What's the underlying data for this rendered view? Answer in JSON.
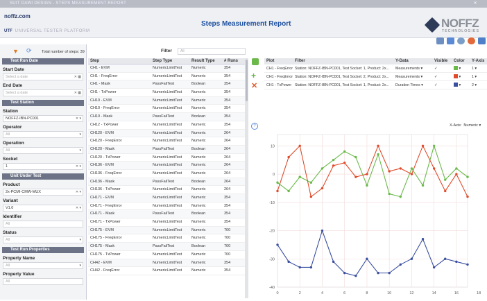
{
  "window": {
    "title": "SUIT DAWI DESIGN - STEPS MEASUREMENT REPORT"
  },
  "header": {
    "logo_text": "noffz.com",
    "app_abbrev": "UTF",
    "app_name": "UNIVERSAL TESTER PLATFORM",
    "report_title": "Steps Measurement Report",
    "brand": "NOFFZ",
    "brand_sub": "TECHNOLOGIES"
  },
  "left_panel": {
    "total_label": "Total number of steps: 39",
    "sections": {
      "test_run_date": "Test Run Date",
      "test_station": "Test Station",
      "unit_under_test": "Unit Under Test",
      "test_run_properties": "Test Run Properties"
    },
    "fields": {
      "start_date": {
        "label": "Start Date",
        "placeholder": "Select a date"
      },
      "end_date": {
        "label": "End Date",
        "placeholder": "Select a date"
      },
      "station": {
        "label": "Station",
        "value": "NOFFZ-IBN-PC001"
      },
      "operator": {
        "label": "Operator",
        "value": "All"
      },
      "operation": {
        "label": "Operation",
        "value": "All"
      },
      "socket": {
        "label": "Socket",
        "value": "1"
      },
      "product": {
        "label": "Product",
        "value": "2x-PCMI-CMW-MUX"
      },
      "variant": {
        "label": "Variant",
        "value": "V1.0"
      },
      "identifier": {
        "label": "Identifier",
        "value": "All"
      },
      "status": {
        "label": "Status",
        "value": "All"
      },
      "property_name": {
        "label": "Property Name",
        "value": "All"
      },
      "property_value": {
        "label": "Property Value",
        "value": "All"
      }
    }
  },
  "filter": {
    "label": "Filter",
    "placeholder": "All"
  },
  "steps_table": {
    "headers": [
      "Step",
      "Step Type",
      "Result Type",
      "# Runs"
    ],
    "rows": [
      [
        "CH1 - EVM",
        "NumericLimitTest",
        "Numeric",
        "354"
      ],
      [
        "CH1 - FreqError",
        "NumericLimitTest",
        "Numeric",
        "354"
      ],
      [
        "CH1 - Mask",
        "PassFailTest",
        "Boolean",
        "354"
      ],
      [
        "CH1 - TxPower",
        "NumericLimitTest",
        "Numeric",
        "354"
      ],
      [
        "CH10 - EVM",
        "NumericLimitTest",
        "Numeric",
        "354"
      ],
      [
        "CH10 - FreqError",
        "NumericLimitTest",
        "Numeric",
        "354"
      ],
      [
        "CH10 - Mask",
        "PassFailTest",
        "Boolean",
        "354"
      ],
      [
        "CH12 - TxPower",
        "NumericLimitTest",
        "Numeric",
        "354"
      ],
      [
        "CH120 - EVM",
        "NumericLimitTest",
        "Numeric",
        "264"
      ],
      [
        "CH120 - FreqError",
        "NumericLimitTest",
        "Numeric",
        "264"
      ],
      [
        "CH120 - Mask",
        "PassFailTest",
        "Boolean",
        "264"
      ],
      [
        "CH120 - TxPower",
        "NumericLimitTest",
        "Numeric",
        "264"
      ],
      [
        "CH136 - EVM",
        "NumericLimitTest",
        "Numeric",
        "264"
      ],
      [
        "CH136 - FreqError",
        "NumericLimitTest",
        "Numeric",
        "264"
      ],
      [
        "CH136 - Mask",
        "PassFailTest",
        "Boolean",
        "264"
      ],
      [
        "CH136 - TxPower",
        "NumericLimitTest",
        "Numeric",
        "264"
      ],
      [
        "CH171 - EVM",
        "NumericLimitTest",
        "Numeric",
        "354"
      ],
      [
        "CH171 - FreqError",
        "NumericLimitTest",
        "Numeric",
        "354"
      ],
      [
        "CH171 - Mask",
        "PassFailTest",
        "Boolean",
        "354"
      ],
      [
        "CH171 - TxPower",
        "NumericLimitTest",
        "Numeric",
        "354"
      ],
      [
        "CH175 - EVM",
        "NumericLimitTest",
        "Numeric",
        "700"
      ],
      [
        "CH175 - FreqError",
        "NumericLimitTest",
        "Numeric",
        "700"
      ],
      [
        "CH175 - Mask",
        "PassFailTest",
        "Boolean",
        "700"
      ],
      [
        "CH175 - TxPower",
        "NumericLimitTest",
        "Numeric",
        "700"
      ],
      [
        "CH42 - EVM",
        "NumericLimitTest",
        "Numeric",
        "354"
      ],
      [
        "CH42 - FreqError",
        "NumericLimitTest",
        "Numeric",
        "354"
      ]
    ]
  },
  "plots_table": {
    "headers": [
      "Plot",
      "Filter",
      "Y-Data",
      "Visible",
      "Color",
      "Y-Axis"
    ],
    "rows": [
      {
        "plot": "CH1 - FreqError",
        "filter": "Station: NOFFZ-IBN-PC001, Test Socket: 1, Product: 2x...",
        "ydata": "Measurements",
        "visible": "✓",
        "color": "#6aba4a",
        "yaxis": "1"
      },
      {
        "plot": "CH1 - FreqError",
        "filter": "Station: NOFFZ-IBN-PC001, Test Socket: 2, Product: 2x...",
        "ydata": "Measurements",
        "visible": "✓",
        "color": "#e04a2a",
        "yaxis": "1"
      },
      {
        "plot": "CH1 - TxPower",
        "filter": "Station: NOFFZ-IBN-PC001, Test Socket: 1, Product: 2x...",
        "ydata": "Duration Times",
        "visible": "✓",
        "color": "#3a4fa0",
        "yaxis": "2"
      }
    ]
  },
  "chart_controls": {
    "x_axis_label": "X-Axis:",
    "x_axis_value": "Numeric"
  },
  "chart_data": {
    "type": "line",
    "x": [
      0,
      1,
      2,
      3,
      4,
      5,
      6,
      7,
      8,
      9,
      10,
      11,
      12,
      13,
      14,
      15,
      16,
      17
    ],
    "series": [
      {
        "name": "CH1 - FreqError",
        "color": "#6aba4a",
        "values": [
          -3,
          -6,
          -1,
          -3,
          2,
          5,
          8,
          6,
          -4,
          7,
          -7,
          -8,
          2,
          -4,
          10,
          -2,
          2,
          -1
        ]
      },
      {
        "name": "CH1 - FreqError",
        "color": "#e04a2a",
        "values": [
          -6,
          6,
          10,
          -8,
          -5,
          3,
          4,
          -1,
          0,
          10,
          1,
          2,
          0,
          10,
          2,
          -6,
          0,
          -8
        ]
      },
      {
        "name": "CH1 - TxPower",
        "color": "#3a4fa0",
        "values": [
          -25,
          -31,
          -33,
          -33,
          -20,
          -31,
          -35,
          -36,
          -30,
          -35,
          -35,
          -32,
          -30,
          -23,
          -33,
          -30,
          -31,
          -32
        ]
      }
    ],
    "xlim": [
      0,
      17
    ],
    "ylim": [
      -40,
      14
    ],
    "y_ticks": [
      10,
      0,
      -10,
      -20,
      -30,
      -40
    ],
    "x_ticks": [
      0,
      2,
      4,
      6,
      8,
      10,
      12,
      14,
      16,
      18
    ],
    "grid": true
  }
}
